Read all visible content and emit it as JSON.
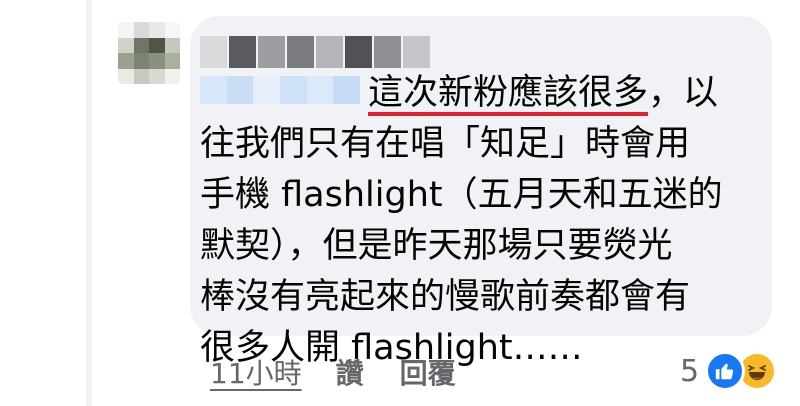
{
  "comment": {
    "text_lines": [
      "這次新粉應該很多",
      "，以",
      "往我們只有在唱「知足」時會用",
      "手機 flashlight（五月天和五迷的",
      "默契），但是昨天那場只要熒光",
      "棒沒有亮起來的慢歌前奏都會有",
      "很多人開 flashlight……"
    ],
    "underline_color": "#e0202a"
  },
  "actions": {
    "time": "11小時",
    "like_label": "讚",
    "reply_label": "回覆"
  },
  "reactions": {
    "count": "5",
    "icons": [
      "thumbs-up-icon",
      "laughing-face-icon"
    ],
    "like_color": "#1877f2",
    "haha_color": "#f7b928"
  },
  "colors": {
    "bubble_bg": "#f0f2f5",
    "text": "#050505",
    "meta_text": "#65676b"
  }
}
